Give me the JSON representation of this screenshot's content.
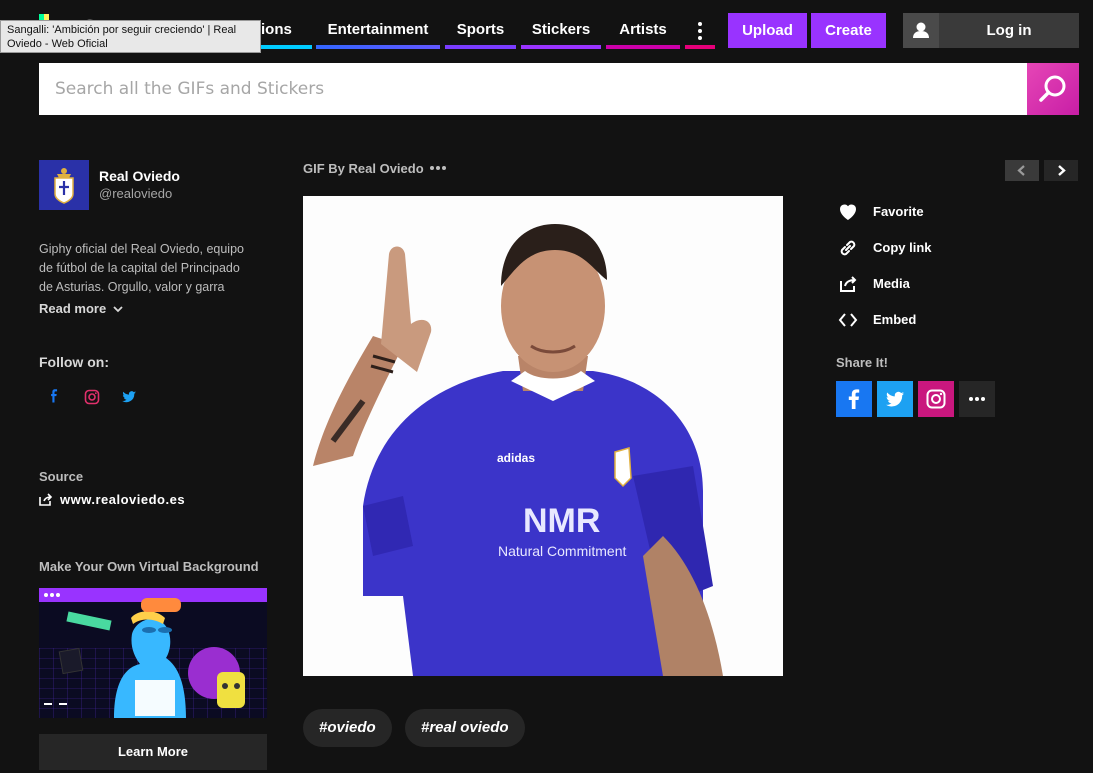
{
  "tooltip": "Sangalli: 'Ambición por seguir creciendo' | Real Oviedo - Web Oficial",
  "nav": {
    "items": [
      {
        "label": "Reactions",
        "color": "#00ccff"
      },
      {
        "label": "Entertainment",
        "color": "#3366ff"
      },
      {
        "label": "Sports",
        "color": "#9933ff"
      },
      {
        "label": "Stickers",
        "color": "#9933ff"
      },
      {
        "label": "Artists",
        "color": "#cc00aa"
      }
    ],
    "upload_label": "Upload",
    "create_label": "Create",
    "login_label": "Log in",
    "accent": "#9933ff"
  },
  "search": {
    "placeholder": "Search all the GIFs and Stickers",
    "button_color": "#e646b6"
  },
  "channel": {
    "name": "Real Oviedo",
    "handle": "@realoviedo",
    "bio": "Giphy oficial del Real Oviedo, equipo de fútbol de la capital del Principado de Asturias. Orgullo, valor y garra",
    "read_more": "Read more",
    "follow_label": "Follow on:",
    "source_label": "Source",
    "source_url": "www.realoviedo.es"
  },
  "virtual_background": {
    "title": "Make Your Own Virtual Background",
    "button": "Learn More"
  },
  "gif": {
    "by_label": "GIF By Real Oviedo",
    "shirt_text": "NMR",
    "shirt_subtext": "Natural Commitment",
    "tags": [
      "#oviedo",
      "#real oviedo"
    ]
  },
  "actions": [
    {
      "label": "Favorite",
      "icon": "heart-icon"
    },
    {
      "label": "Copy link",
      "icon": "link-icon"
    },
    {
      "label": "Media",
      "icon": "share-out-icon"
    },
    {
      "label": "Embed",
      "icon": "code-icon"
    }
  ],
  "share": {
    "label": "Share It!",
    "buttons": [
      {
        "network": "facebook",
        "color": "#1877f2"
      },
      {
        "network": "twitter",
        "color": "#1da1f2"
      },
      {
        "network": "instagram",
        "color": "#c9177e"
      },
      {
        "network": "more",
        "color": "#262626"
      }
    ]
  }
}
